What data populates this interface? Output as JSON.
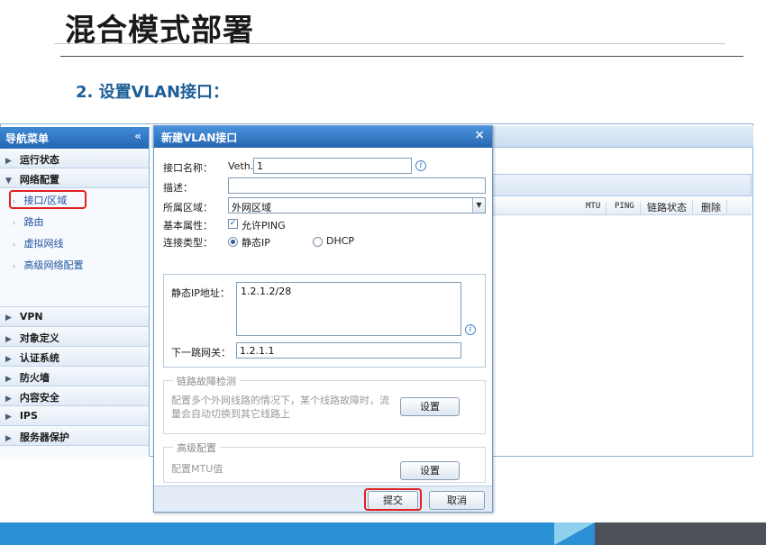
{
  "slide": {
    "title": "混合模式部署",
    "section": "2. 设置VLAN接口："
  },
  "sidebar": {
    "header": "导航菜单",
    "collapse_glyph": "«",
    "groups": [
      {
        "label": "运行状态",
        "expanded": false
      },
      {
        "label": "网络配置",
        "expanded": true
      },
      {
        "label": "VPN",
        "expanded": false
      },
      {
        "label": "对象定义",
        "expanded": false
      },
      {
        "label": "认证系统",
        "expanded": false
      },
      {
        "label": "防火墙",
        "expanded": false
      },
      {
        "label": "内容安全",
        "expanded": false
      },
      {
        "label": "IPS",
        "expanded": false
      },
      {
        "label": "服务器保护",
        "expanded": false
      }
    ],
    "network_items": [
      {
        "label": "接口/区域",
        "active": true
      },
      {
        "label": "路由"
      },
      {
        "label": "虚拟网线"
      },
      {
        "label": "高级网络配置"
      }
    ]
  },
  "main": {
    "columns": [
      "MTU",
      "PING",
      "链路状态",
      "删除"
    ]
  },
  "dialog": {
    "title": "新建VLAN接口",
    "close_glyph": "×",
    "name_label": "接口名称：",
    "name_prefix": "Veth.",
    "name_value": "1",
    "desc_label": "描述：",
    "desc_value": "",
    "zone_label": "所属区域：",
    "zone_value": "外网区域",
    "attr_label": "基本属性：",
    "allow_ping_label": "允许PING",
    "allow_ping_checked": true,
    "conn_label": "连接类型：",
    "conn_static": "静态IP",
    "conn_dhcp": "DHCP",
    "conn_selected": "静态IP",
    "static_ip_label": "静态IP地址：",
    "static_ip_value": "1.2.1.2/28",
    "gateway_label": "下一跳网关：",
    "gateway_value": "1.2.1.1",
    "link_detect_legend": "链路故障检测",
    "link_detect_text_1": "配置多个外网线路的情况下，某个线路故障时，流",
    "link_detect_text_2": "量会自动切换到其它线路上",
    "link_detect_button": "设置",
    "advanced_legend": "高级配置",
    "advanced_text": "配置MTU值",
    "advanced_button": "设置",
    "submit_label": "提交",
    "cancel_label": "取消"
  },
  "colors": {
    "accent": "#2466b3",
    "highlight": "#e02020",
    "heading": "#1c5e97",
    "band": "#2b8fd6"
  }
}
